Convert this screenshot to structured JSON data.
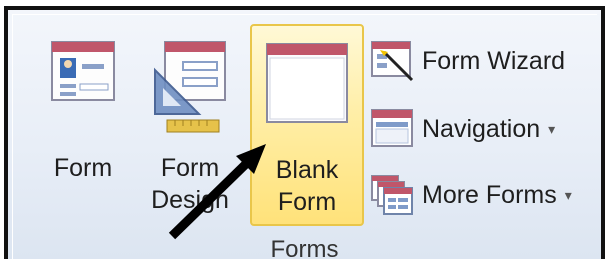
{
  "ribbon": {
    "group_label": "Forms",
    "big_buttons": [
      {
        "label_lines": [
          "Form"
        ],
        "icon": "form-icon"
      },
      {
        "label_lines": [
          "Form",
          "Design"
        ],
        "icon": "form-design-icon"
      },
      {
        "label_lines": [
          "Blank",
          "Form"
        ],
        "icon": "blank-form-icon",
        "highlighted": true
      }
    ],
    "small_buttons": [
      {
        "label": "Form Wizard",
        "icon": "form-wizard-icon",
        "dropdown": false
      },
      {
        "label": "Navigation",
        "icon": "navigation-icon",
        "dropdown": true
      },
      {
        "label": "More Forms",
        "icon": "more-forms-icon",
        "dropdown": true
      }
    ],
    "dropdown_glyph": "▾"
  },
  "colors": {
    "highlight_fill": "#ffe27a",
    "highlight_border": "#e9c64a",
    "arrow": "#000000"
  }
}
